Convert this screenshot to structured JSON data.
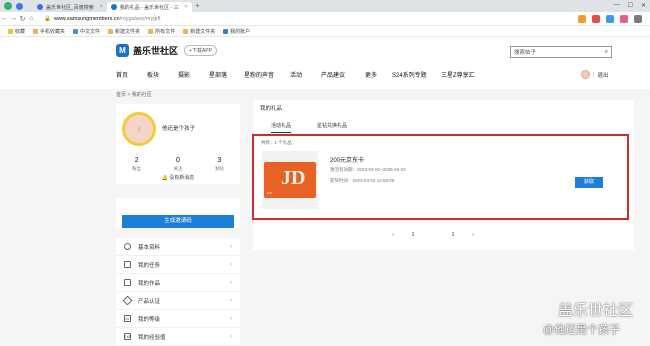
{
  "browser": {
    "tabs": [
      {
        "label": "盖乐世社区_百度搜索",
        "active": false
      },
      {
        "label": "我的礼品 - 盖乐世社区 - 三",
        "active": true
      }
    ],
    "url_host": "www.samsungmembers.cn",
    "url_path": "/mygalaxy/mygift",
    "bookmarks": [
      "收藏",
      "手机收藏夹",
      "中文文件",
      "新建文件夹",
      "所有文件",
      "新建文件夹",
      "我的账户"
    ]
  },
  "site": {
    "logo_text": "盖乐世社区",
    "download_label": "下载APP",
    "search_placeholder": "搜索帖子",
    "nav": [
      "首页",
      "板块",
      "摄影",
      "星部落",
      "星粉的声音",
      "活动",
      "产品建议",
      "更多",
      "S24系列专题",
      "三星Z尊享汇"
    ],
    "logout_label": "退出"
  },
  "breadcrumb": "首页 > 我的社区",
  "profile": {
    "nickname": "他还是个孩子",
    "stats": [
      {
        "value": "2",
        "label": "粉丝"
      },
      {
        "value": "0",
        "label": "关注"
      },
      {
        "value": "3",
        "label": "发帖"
      }
    ],
    "no_message": "没有新消息"
  },
  "generate_label": "生成邀请码",
  "menu": [
    "基本资料",
    "我的任务",
    "我的作品",
    "产品认证",
    "我的等级",
    "我的经验值"
  ],
  "gifts": {
    "title": "我的礼品",
    "tabs": [
      "活动礼品",
      "星钻兑换礼品"
    ],
    "count_line": "共有：1 个礼品",
    "item": {
      "name": "200元京东卡",
      "valid": "激活有效期：2023-03-02~2026-03-02",
      "obtained": "获奖时间：2023-03-02 14:58:06",
      "claim_label": "获取"
    }
  },
  "pager": {
    "prev": "‹",
    "pages": [
      "1",
      "",
      "1"
    ],
    "next": "›"
  },
  "watermark": {
    "title": "盖乐世社区",
    "sub": "@他还是个孩子"
  },
  "colors": {
    "brand_blue": "#1f7fd6",
    "highlight_red": "#d62a2a",
    "jd_orange": "#e86226"
  }
}
